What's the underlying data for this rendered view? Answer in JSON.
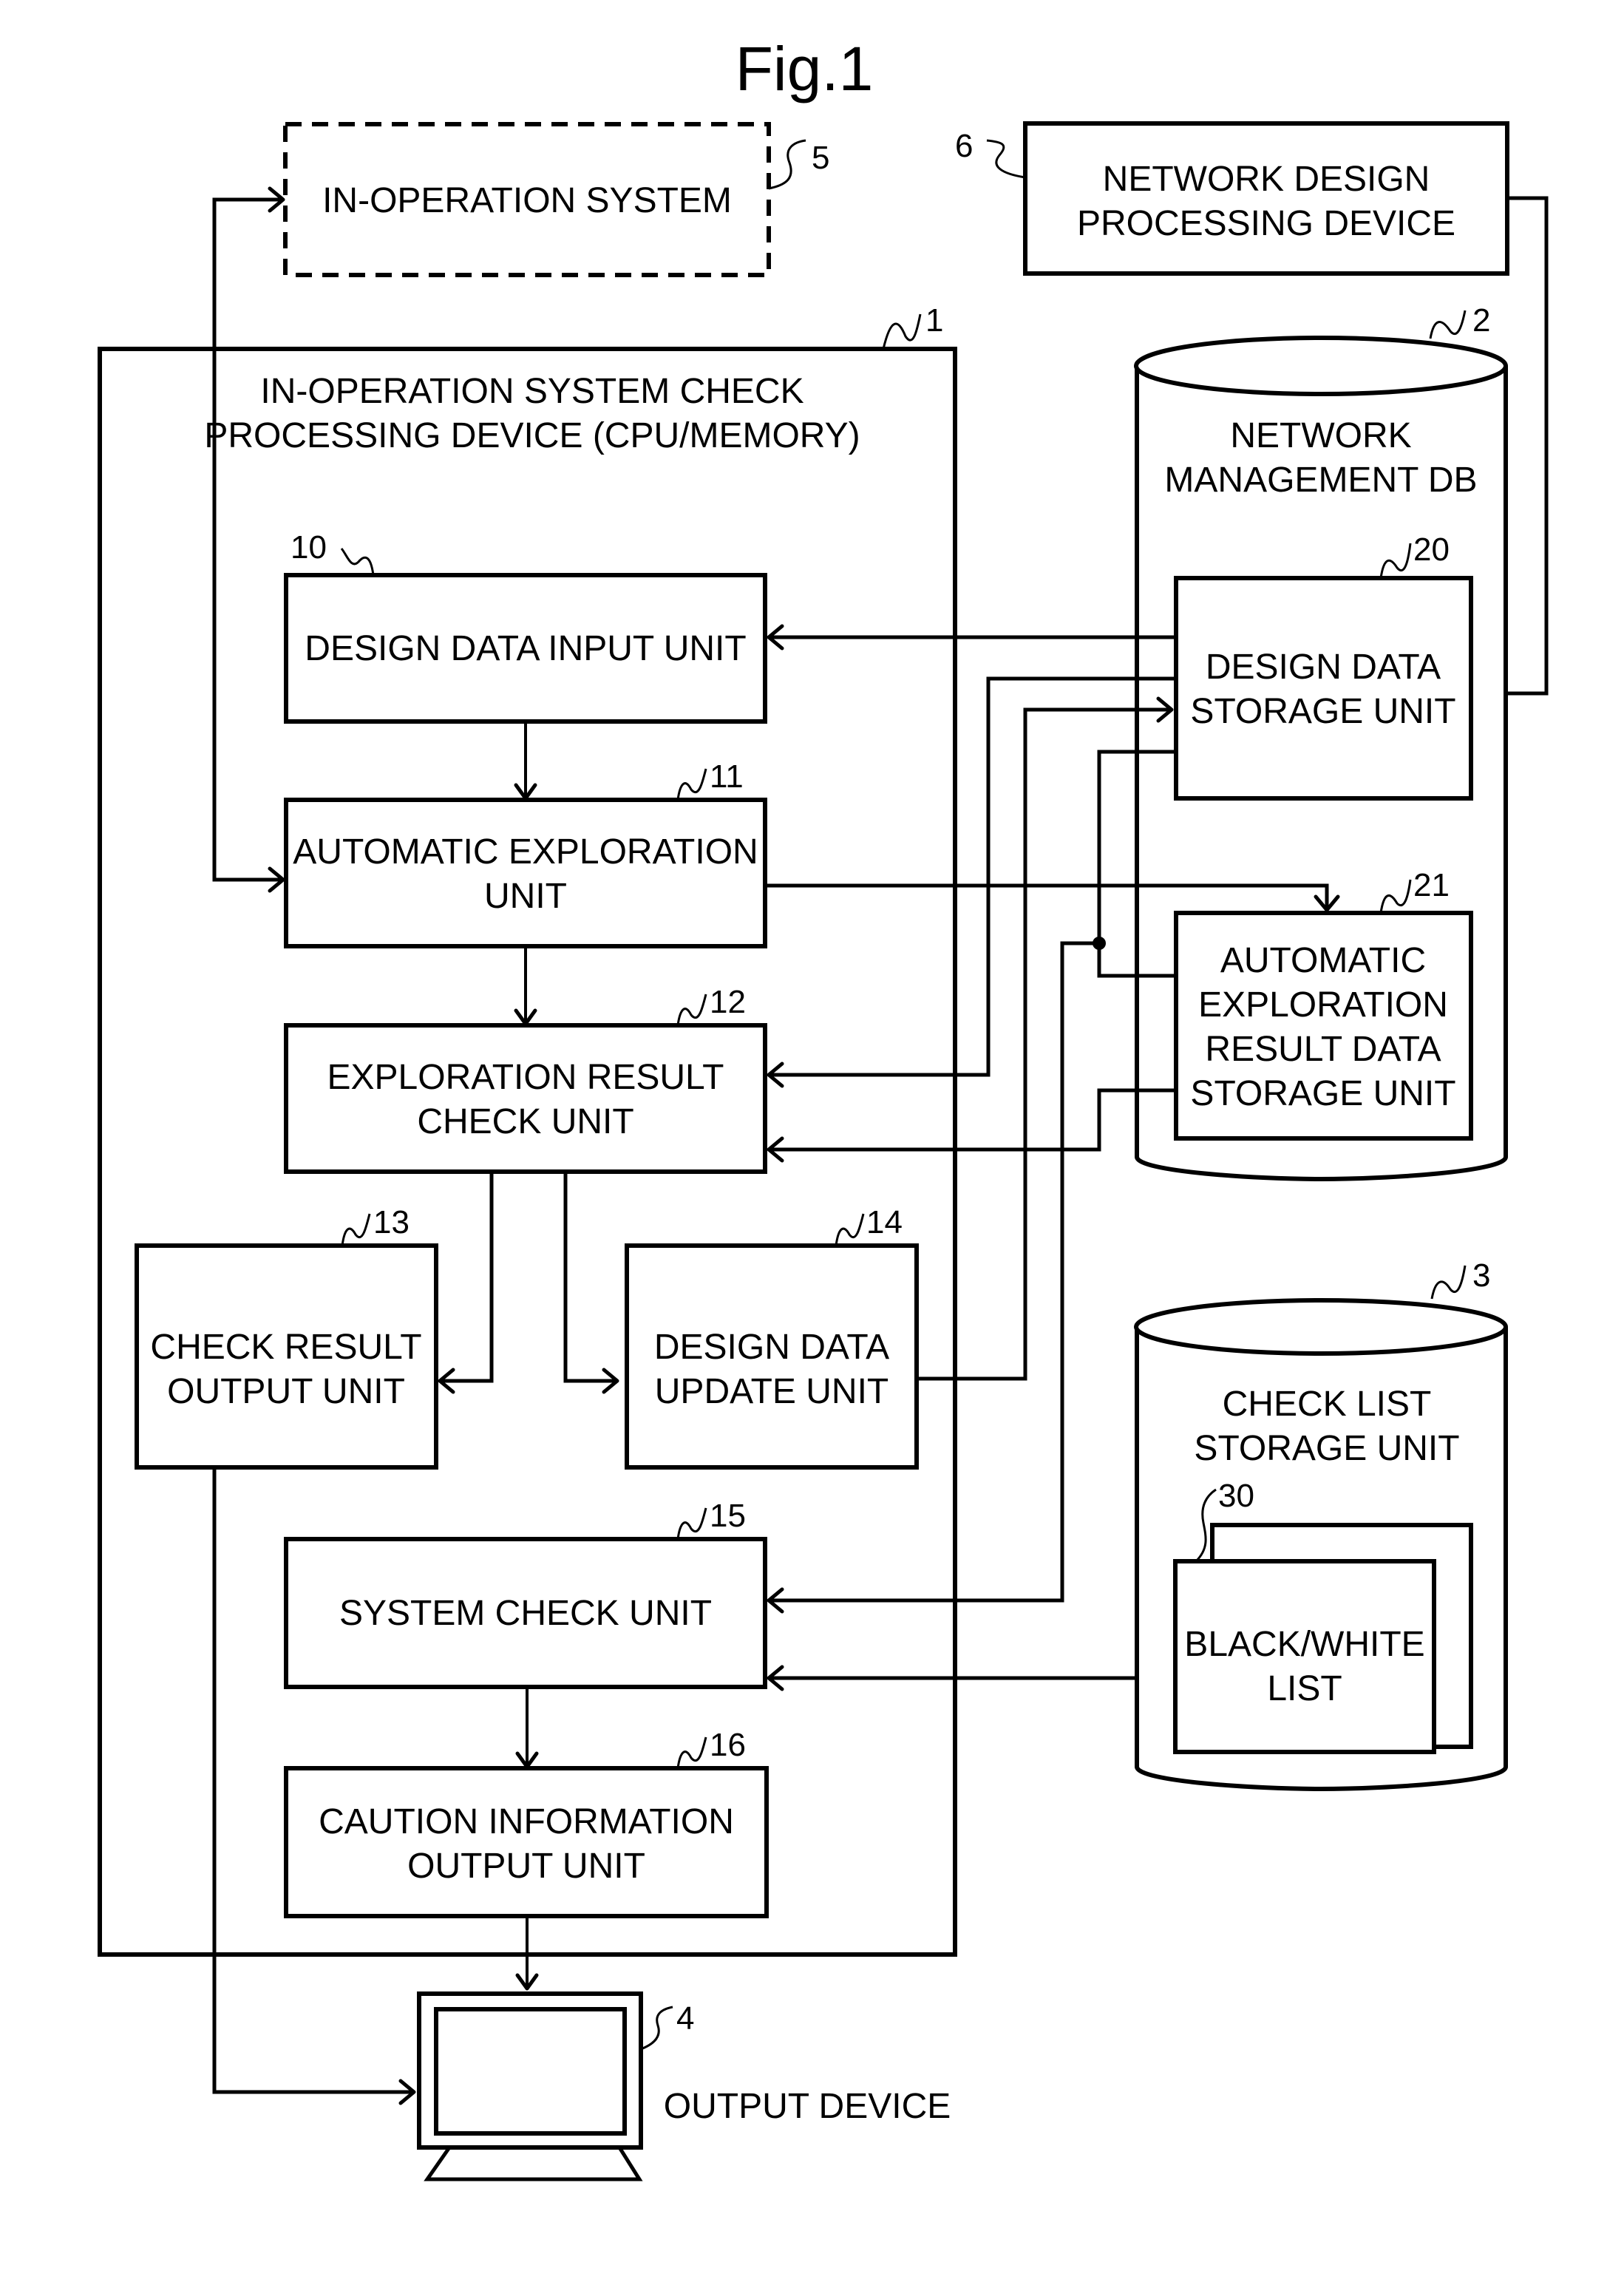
{
  "figure": {
    "title": "Fig.1"
  },
  "blocks": {
    "in_operation_system": {
      "ref": "5",
      "lines": [
        "IN-OPERATION SYSTEM"
      ]
    },
    "network_design_device": {
      "ref": "6",
      "lines": [
        "NETWORK DESIGN",
        "PROCESSING DEVICE"
      ]
    },
    "check_processing_device": {
      "ref": "1",
      "lines": [
        "IN-OPERATION SYSTEM CHECK",
        "PROCESSING DEVICE (CPU/MEMORY)"
      ]
    },
    "network_management_db": {
      "ref": "2",
      "lines": [
        "NETWORK",
        "MANAGEMENT DB"
      ]
    },
    "design_data_storage": {
      "ref": "20",
      "lines": [
        "DESIGN DATA",
        "STORAGE UNIT"
      ]
    },
    "exploration_result_storage": {
      "ref": "21",
      "lines": [
        "AUTOMATIC",
        "EXPLORATION",
        "RESULT DATA",
        "STORAGE UNIT"
      ]
    },
    "design_data_input": {
      "ref": "10",
      "lines": [
        "DESIGN DATA INPUT UNIT"
      ]
    },
    "automatic_exploration": {
      "ref": "11",
      "lines": [
        "AUTOMATIC EXPLORATION",
        "UNIT"
      ]
    },
    "exploration_result_check": {
      "ref": "12",
      "lines": [
        "EXPLORATION RESULT",
        "CHECK UNIT"
      ]
    },
    "check_result_output": {
      "ref": "13",
      "lines": [
        "CHECK RESULT",
        "OUTPUT UNIT"
      ]
    },
    "design_data_update": {
      "ref": "14",
      "lines": [
        "DESIGN DATA",
        "UPDATE UNIT"
      ]
    },
    "system_check": {
      "ref": "15",
      "lines": [
        "SYSTEM CHECK UNIT"
      ]
    },
    "caution_info_output": {
      "ref": "16",
      "lines": [
        "CAUTION INFORMATION",
        "OUTPUT UNIT"
      ]
    },
    "check_list_storage": {
      "ref": "3",
      "lines": [
        "CHECK LIST",
        "STORAGE UNIT"
      ]
    },
    "black_white_list": {
      "ref": "30",
      "lines": [
        "BLACK/WHITE",
        "LIST"
      ]
    },
    "output_device": {
      "ref": "4",
      "lines": [
        "OUTPUT DEVICE"
      ]
    }
  }
}
